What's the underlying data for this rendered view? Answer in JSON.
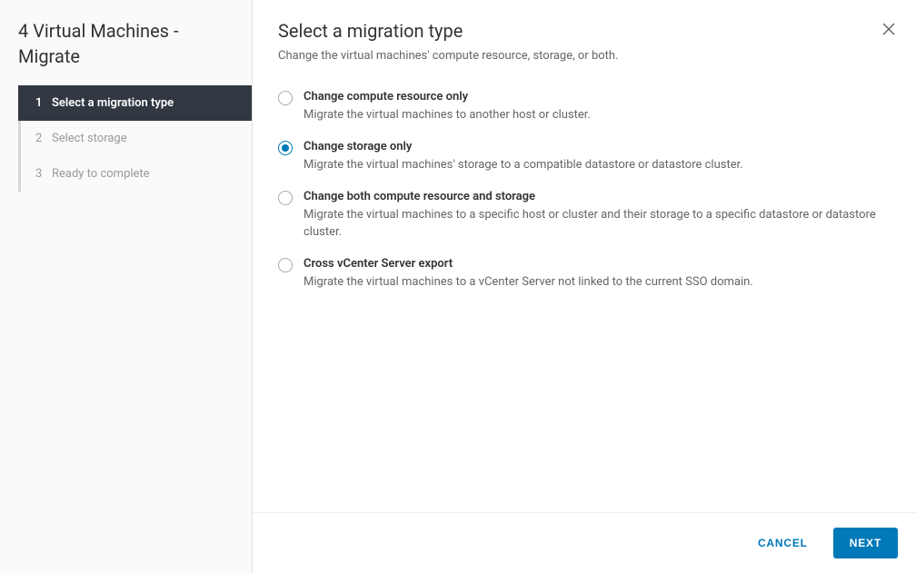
{
  "sidebar": {
    "title": "4 Virtual Machines - Migrate",
    "steps": [
      {
        "num": "1",
        "label": "Select a migration type",
        "active": true
      },
      {
        "num": "2",
        "label": "Select storage",
        "active": false
      },
      {
        "num": "3",
        "label": "Ready to complete",
        "active": false
      }
    ]
  },
  "main": {
    "title": "Select a migration type",
    "subtitle": "Change the virtual machines' compute resource, storage, or both.",
    "options": [
      {
        "label": "Change compute resource only",
        "desc": "Migrate the virtual machines to another host or cluster.",
        "selected": false
      },
      {
        "label": "Change storage only",
        "desc": "Migrate the virtual machines' storage to a compatible datastore or datastore cluster.",
        "selected": true
      },
      {
        "label": "Change both compute resource and storage",
        "desc": "Migrate the virtual machines to a specific host or cluster and their storage to a specific datastore or datastore cluster.",
        "selected": false
      },
      {
        "label": "Cross vCenter Server export",
        "desc": "Migrate the virtual machines to a vCenter Server not linked to the current SSO domain.",
        "selected": false
      }
    ]
  },
  "footer": {
    "cancel": "CANCEL",
    "next": "NEXT"
  }
}
